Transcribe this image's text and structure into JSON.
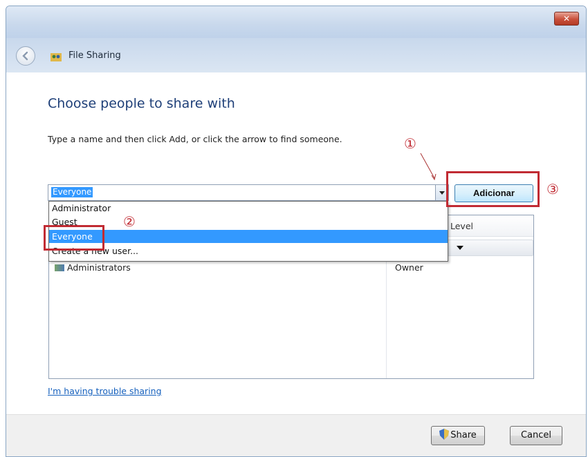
{
  "window": {
    "close_label": "✕",
    "nav_title": "File Sharing"
  },
  "main": {
    "title": "Choose people to share with",
    "instruction": "Type a name and then click Add, or click the arrow to find someone.",
    "combo_value": "Everyone",
    "add_button": "Adicionar",
    "dropdown_options": [
      "Administrator",
      "Guest",
      "Everyone",
      "Create a new user..."
    ],
    "selected_option_index": 2,
    "column_header": "Level",
    "list_rows": [
      {
        "name": "Administrators",
        "level": "Owner"
      }
    ],
    "trouble_link": "I'm having trouble sharing"
  },
  "footer": {
    "share_button": "Share",
    "cancel_button": "Cancel"
  },
  "annotations": {
    "marker_1": "①",
    "marker_2": "②",
    "marker_3": "③",
    "highlight_color": "#c12b33"
  },
  "icons": {
    "back": "back-arrow-icon",
    "share": "share-folder-icon",
    "shield": "uac-shield-icon"
  }
}
